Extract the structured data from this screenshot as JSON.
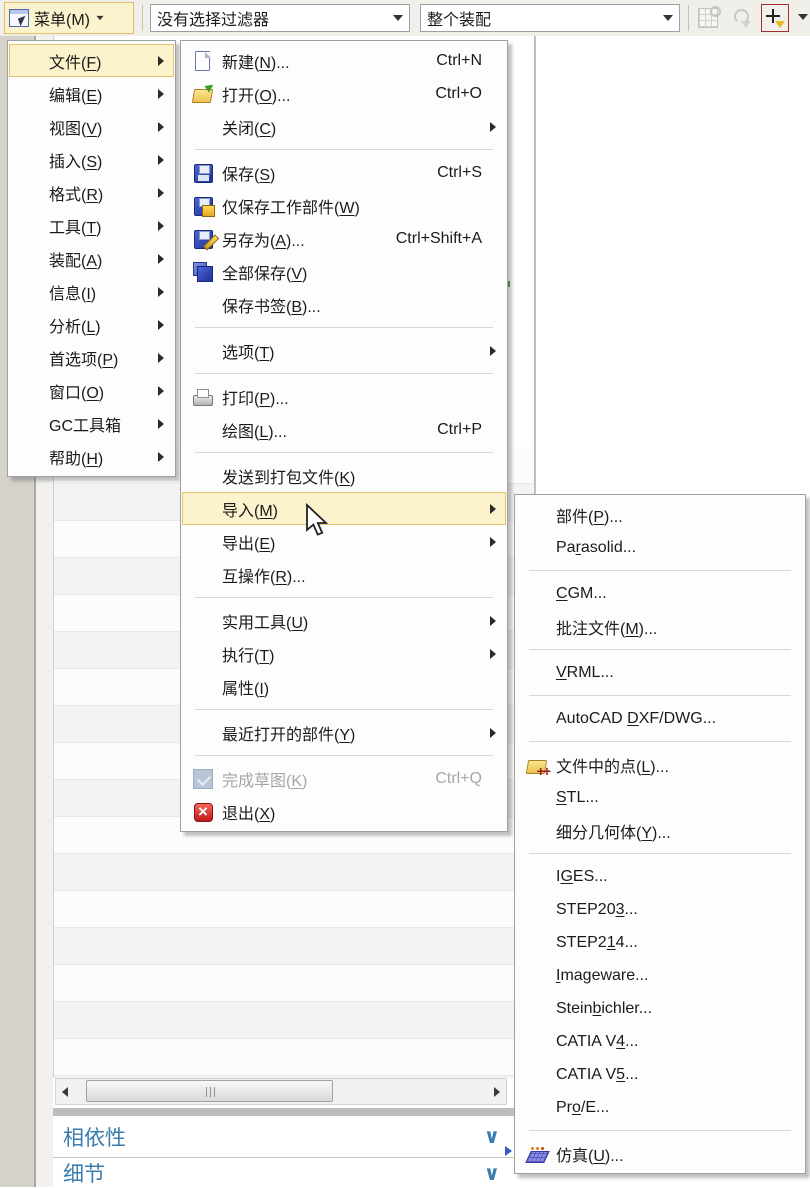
{
  "toolbar": {
    "menu_button": {
      "label": "菜单(M)"
    },
    "filter_dropdown": {
      "value": "没有选择过滤器"
    },
    "scope_dropdown": {
      "value": "整个装配"
    }
  },
  "main_menu": {
    "items": [
      {
        "id": "file",
        "pre": "文件(",
        "u": "F",
        "post": ")",
        "submenu": true,
        "highlight": true
      },
      {
        "id": "edit",
        "pre": "编辑(",
        "u": "E",
        "post": ")",
        "submenu": true
      },
      {
        "id": "view",
        "pre": "视图(",
        "u": "V",
        "post": ")",
        "submenu": true
      },
      {
        "id": "insert",
        "pre": "插入(",
        "u": "S",
        "post": ")",
        "submenu": true
      },
      {
        "id": "format",
        "pre": "格式(",
        "u": "R",
        "post": ")",
        "submenu": true
      },
      {
        "id": "tools",
        "pre": "工具(",
        "u": "T",
        "post": ")",
        "submenu": true
      },
      {
        "id": "assemblies",
        "pre": "装配(",
        "u": "A",
        "post": ")",
        "submenu": true
      },
      {
        "id": "information",
        "pre": "信息(",
        "u": "I",
        "post": ")",
        "submenu": true
      },
      {
        "id": "analysis",
        "pre": "分析(",
        "u": "L",
        "post": ")",
        "submenu": true
      },
      {
        "id": "preferences",
        "pre": "首选项(",
        "u": "P",
        "post": ")",
        "submenu": true
      },
      {
        "id": "window",
        "pre": "窗口(",
        "u": "O",
        "post": ")",
        "submenu": true
      },
      {
        "id": "gc-toolbox",
        "pre": "GC工具箱",
        "u": "",
        "post": "",
        "submenu": true
      },
      {
        "id": "help",
        "pre": "帮助(",
        "u": "H",
        "post": ")",
        "submenu": true
      }
    ]
  },
  "file_menu": {
    "items": [
      {
        "id": "new",
        "pre": "新建(",
        "u": "N",
        "post": ")...",
        "shortcut": "Ctrl+N",
        "icon": "new-file-icon"
      },
      {
        "id": "open",
        "pre": "打开(",
        "u": "O",
        "post": ")...",
        "shortcut": "Ctrl+O",
        "icon": "open-folder-icon"
      },
      {
        "id": "close",
        "pre": "关闭(",
        "u": "C",
        "post": ")",
        "submenu": true,
        "sep": true
      },
      {
        "id": "save",
        "pre": "保存(",
        "u": "S",
        "post": ")",
        "shortcut": "Ctrl+S",
        "icon": "save-icon"
      },
      {
        "id": "save-work-part-only",
        "pre": "仅保存工作部件(",
        "u": "W",
        "post": ")",
        "icon": "save-work-icon"
      },
      {
        "id": "save-as",
        "pre": "另存为(",
        "u": "A",
        "post": ")...",
        "shortcut": "Ctrl+Shift+A",
        "icon": "save-as-icon"
      },
      {
        "id": "save-all",
        "pre": "全部保存(",
        "u": "V",
        "post": ")",
        "icon": "save-all-icon"
      },
      {
        "id": "save-bookmark",
        "pre": "保存书签(",
        "u": "B",
        "post": ")...",
        "sep": true
      },
      {
        "id": "options",
        "pre": "选项(",
        "u": "T",
        "post": ")",
        "submenu": true,
        "sep": true
      },
      {
        "id": "print",
        "pre": "打印(",
        "u": "P",
        "post": ")...",
        "icon": "printer-icon"
      },
      {
        "id": "plot",
        "pre": "绘图(",
        "u": "L",
        "post": ")...",
        "shortcut": "Ctrl+P",
        "sep": true
      },
      {
        "id": "send-to-package-file",
        "pre": "发送到打包文件(",
        "u": "K",
        "post": ")"
      },
      {
        "id": "import",
        "pre": "导入(",
        "u": "M",
        "post": ")",
        "submenu": true,
        "highlight": true
      },
      {
        "id": "export",
        "pre": "导出(",
        "u": "E",
        "post": ")",
        "submenu": true
      },
      {
        "id": "interop",
        "pre": "互操作(",
        "u": "R",
        "post": ")...",
        "sep": true
      },
      {
        "id": "utilities",
        "pre": "实用工具(",
        "u": "U",
        "post": ")",
        "submenu": true
      },
      {
        "id": "execute",
        "pre": "执行(",
        "u": "T",
        "post": ")",
        "submenu": true
      },
      {
        "id": "properties",
        "pre": "属性(",
        "u": "I",
        "post": ")",
        "sep": true
      },
      {
        "id": "recently-opened-parts",
        "pre": "最近打开的部件(",
        "u": "Y",
        "post": ")",
        "submenu": true,
        "sep": true
      },
      {
        "id": "finish-sketch",
        "pre": "完成草图(",
        "u": "K",
        "post": ")",
        "shortcut": "Ctrl+Q",
        "icon": "finish-sketch-icon",
        "disabled": true
      },
      {
        "id": "exit",
        "pre": "退出(",
        "u": "X",
        "post": ")",
        "icon": "exit-icon"
      }
    ]
  },
  "import_menu": {
    "items": [
      {
        "id": "part",
        "pre": "部件(",
        "u": "P",
        "post": ")..."
      },
      {
        "id": "parasolid",
        "pre": "Pa",
        "u": "r",
        "post": "asolid...",
        "sep": true
      },
      {
        "id": "cgm",
        "pre": "",
        "u": "C",
        "post": "GM..."
      },
      {
        "id": "annotation-file",
        "pre": "批注文件(",
        "u": "M",
        "post": ")...",
        "sep": true
      },
      {
        "id": "vrml",
        "pre": "",
        "u": "V",
        "post": "RML...",
        "sep": true
      },
      {
        "id": "autocad-dxf-dwg",
        "pre": "AutoCAD ",
        "u": "D",
        "post": "XF/DWG...",
        "sep": true
      },
      {
        "id": "points-from-file",
        "pre": "文件中的点(",
        "u": "L",
        "post": ")...",
        "icon": "points-file-icon"
      },
      {
        "id": "stl",
        "pre": "",
        "u": "S",
        "post": "TL..."
      },
      {
        "id": "subdivision-geometry",
        "pre": "细分几何体(",
        "u": "Y",
        "post": ")...",
        "sep": true
      },
      {
        "id": "iges",
        "pre": "I",
        "u": "G",
        "post": "ES..."
      },
      {
        "id": "step203",
        "pre": "STEP20",
        "u": "3",
        "post": "..."
      },
      {
        "id": "step214",
        "pre": "STEP2",
        "u": "1",
        "post": "4..."
      },
      {
        "id": "imageware",
        "pre": "",
        "u": "I",
        "post": "mageware..."
      },
      {
        "id": "steinbichler",
        "pre": "Stein",
        "u": "b",
        "post": "ichler..."
      },
      {
        "id": "catia-v4",
        "pre": "CATIA V",
        "u": "4",
        "post": "..."
      },
      {
        "id": "catia-v5",
        "pre": "CATIA V",
        "u": "5",
        "post": "..."
      },
      {
        "id": "pro-e",
        "pre": "Pr",
        "u": "o",
        "post": "/E...",
        "sep": true
      },
      {
        "id": "simulation",
        "pre": "仿真(",
        "u": "U",
        "post": ")...",
        "icon": "simulation-icon"
      }
    ]
  },
  "bottom_panels": {
    "dependencies": {
      "title": "相依性"
    },
    "details": {
      "title": "细节"
    }
  },
  "colors": {
    "menu_highlight_bg": "#fcf3cd",
    "menu_highlight_border": "#dfc36a",
    "panel_title": "#3a7cae",
    "toolbar_bg": "#f1efe9",
    "snap_icon_frame": "#a03030",
    "exit_icon": "#c01818"
  }
}
